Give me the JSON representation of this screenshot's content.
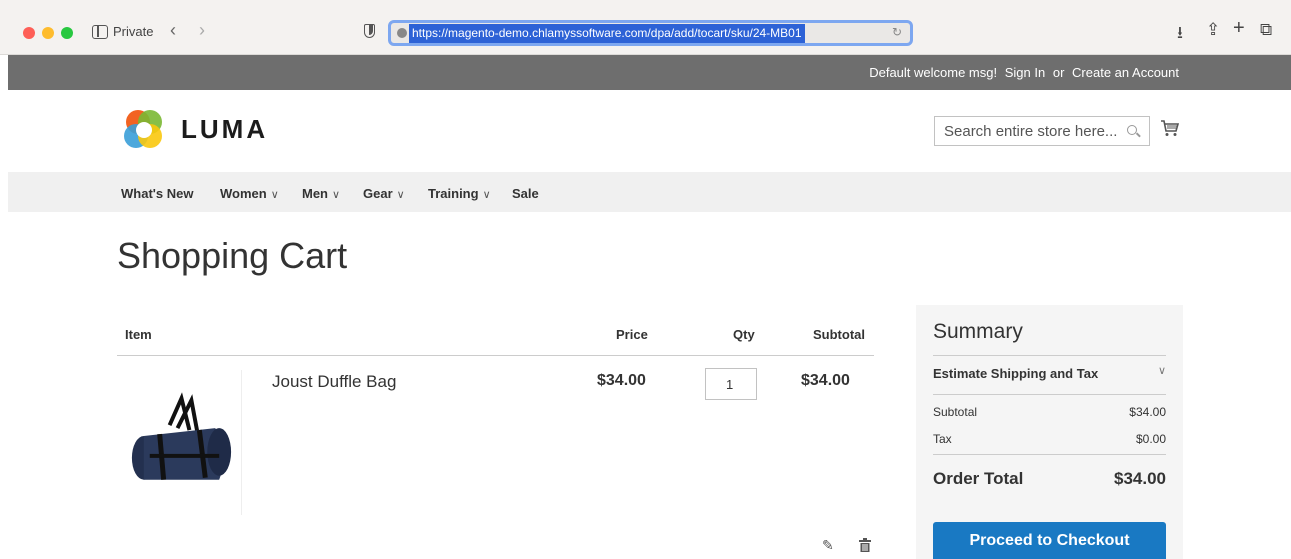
{
  "browser": {
    "private_label": "Private",
    "url": "https://magento-demo.chlamyssoftware.com/dpa/add/tocart/sku/24-MB01"
  },
  "topbar": {
    "welcome": "Default welcome msg!",
    "sign_in": "Sign In",
    "or": "or",
    "create_account": "Create an Account"
  },
  "header": {
    "logo_text": "LUMA",
    "search_placeholder": "Search entire store here..."
  },
  "nav": {
    "items": [
      {
        "label": "What's New",
        "dropdown": false
      },
      {
        "label": "Women",
        "dropdown": true
      },
      {
        "label": "Men",
        "dropdown": true
      },
      {
        "label": "Gear",
        "dropdown": true
      },
      {
        "label": "Training",
        "dropdown": true
      },
      {
        "label": "Sale",
        "dropdown": false
      }
    ]
  },
  "page": {
    "title": "Shopping Cart"
  },
  "cart": {
    "headers": {
      "item": "Item",
      "price": "Price",
      "qty": "Qty",
      "subtotal": "Subtotal"
    },
    "items": [
      {
        "name": "Joust Duffle Bag",
        "price": "$34.00",
        "qty": "1",
        "subtotal": "$34.00"
      }
    ]
  },
  "summary": {
    "title": "Summary",
    "estimate_label": "Estimate Shipping and Tax",
    "subtotal_label": "Subtotal",
    "subtotal_value": "$34.00",
    "tax_label": "Tax",
    "tax_value": "$0.00",
    "order_total_label": "Order Total",
    "order_total_value": "$34.00",
    "checkout_label": "Proceed to Checkout"
  },
  "colors": {
    "accent": "#1979c3",
    "topbar": "#6e6e6e",
    "url_highlight": "#2d62d6"
  }
}
